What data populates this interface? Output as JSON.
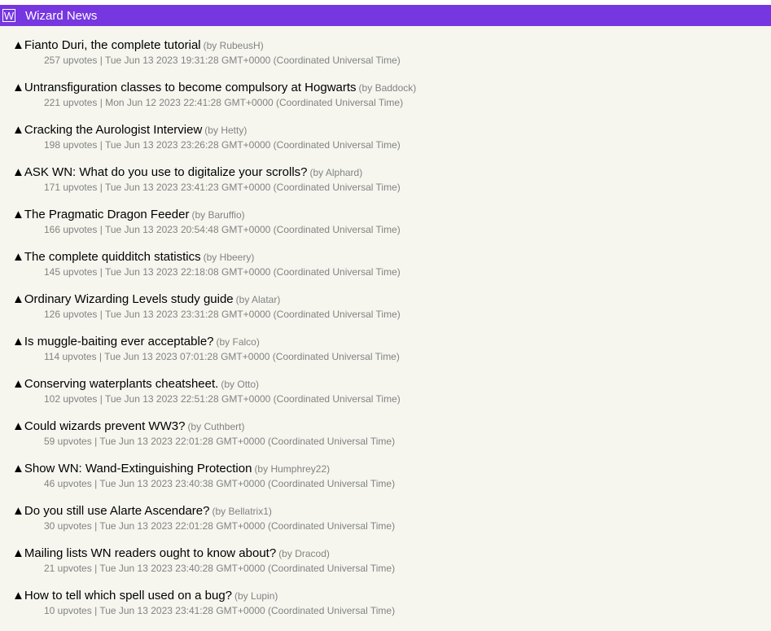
{
  "header": {
    "logo_letter": "W",
    "site_name": "Wizard News"
  },
  "vote_glyph": "▲",
  "separator": "|",
  "items": [
    {
      "title": "Fianto Duri, the complete tutorial",
      "author": "RubeusH",
      "upvotes": "257 upvotes",
      "date": "Tue Jun 13 2023 19:31:28 GMT+0000 (Coordinated Universal Time)"
    },
    {
      "title": "Untransfiguration classes to become compulsory at Hogwarts",
      "author": "Baddock",
      "upvotes": "221 upvotes",
      "date": "Mon Jun 12 2023 22:41:28 GMT+0000 (Coordinated Universal Time)"
    },
    {
      "title": "Cracking the Aurologist Interview",
      "author": "Hetty",
      "upvotes": "198 upvotes",
      "date": "Tue Jun 13 2023 23:26:28 GMT+0000 (Coordinated Universal Time)"
    },
    {
      "title": "ASK WN: What do you use to digitalize your scrolls?",
      "author": "Alphard",
      "upvotes": "171 upvotes",
      "date": "Tue Jun 13 2023 23:41:23 GMT+0000 (Coordinated Universal Time)"
    },
    {
      "title": "The Pragmatic Dragon Feeder",
      "author": "Baruffio",
      "upvotes": "166 upvotes",
      "date": "Tue Jun 13 2023 20:54:48 GMT+0000 (Coordinated Universal Time)"
    },
    {
      "title": "The complete quidditch statistics",
      "author": "Hbeery",
      "upvotes": "145 upvotes",
      "date": "Tue Jun 13 2023 22:18:08 GMT+0000 (Coordinated Universal Time)"
    },
    {
      "title": "Ordinary Wizarding Levels study guide",
      "author": "Alatar",
      "upvotes": "126 upvotes",
      "date": "Tue Jun 13 2023 23:31:28 GMT+0000 (Coordinated Universal Time)"
    },
    {
      "title": "Is muggle-baiting ever acceptable?",
      "author": "Falco",
      "upvotes": "114 upvotes",
      "date": "Tue Jun 13 2023 07:01:28 GMT+0000 (Coordinated Universal Time)"
    },
    {
      "title": "Conserving waterplants cheatsheet.",
      "author": "Otto",
      "upvotes": "102 upvotes",
      "date": "Tue Jun 13 2023 22:51:28 GMT+0000 (Coordinated Universal Time)"
    },
    {
      "title": "Could wizards prevent WW3?",
      "author": "Cuthbert",
      "upvotes": "59 upvotes",
      "date": "Tue Jun 13 2023 22:01:28 GMT+0000 (Coordinated Universal Time)"
    },
    {
      "title": "Show WN: Wand-Extinguishing Protection",
      "author": "Humphrey22",
      "upvotes": "46 upvotes",
      "date": "Tue Jun 13 2023 23:40:38 GMT+0000 (Coordinated Universal Time)"
    },
    {
      "title": "Do you still use Alarte Ascendare?",
      "author": "Bellatrix1",
      "upvotes": "30 upvotes",
      "date": "Tue Jun 13 2023 22:01:28 GMT+0000 (Coordinated Universal Time)"
    },
    {
      "title": "Mailing lists WN readers ought to know about?",
      "author": "Dracod",
      "upvotes": "21 upvotes",
      "date": "Tue Jun 13 2023 23:40:28 GMT+0000 (Coordinated Universal Time)"
    },
    {
      "title": "How to tell which spell used on a bug?",
      "author": "Lupin",
      "upvotes": "10 upvotes",
      "date": "Tue Jun 13 2023 23:41:28 GMT+0000 (Coordinated Universal Time)"
    }
  ]
}
